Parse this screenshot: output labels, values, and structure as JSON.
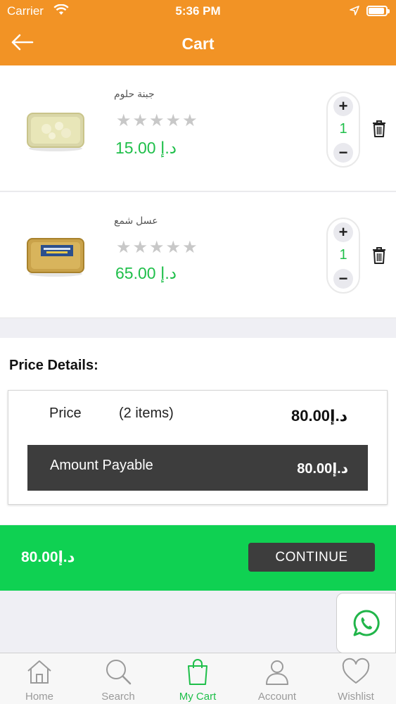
{
  "status_bar": {
    "carrier": "Carrier",
    "time": "5:36 PM"
  },
  "header": {
    "title": "Cart"
  },
  "cart_items": [
    {
      "name": "جبنة حلوم",
      "rating": 0,
      "price": "15.00 د.إ",
      "quantity": "1"
    },
    {
      "name": "عسل شمع",
      "rating": 0,
      "price": "65.00 د.إ",
      "quantity": "1"
    }
  ],
  "stepper": {
    "plus": "+",
    "minus": "−"
  },
  "price_details": {
    "heading": "Price Details:",
    "price_label": "Price",
    "items_count": "(2 items)",
    "price_value": "80.00د.إ",
    "amount_label": "Amount Payable",
    "amount_value": "80.00د.إ"
  },
  "footer": {
    "total": "80.00د.إ",
    "continue_label": "CONTINUE"
  },
  "tabs": [
    {
      "label": "Home",
      "icon": "home-icon",
      "active": false
    },
    {
      "label": "Search",
      "icon": "search-icon",
      "active": false
    },
    {
      "label": "My Cart",
      "icon": "shopping-bag-icon",
      "active": true
    },
    {
      "label": "Account",
      "icon": "user-icon",
      "active": false
    },
    {
      "label": "Wishlist",
      "icon": "heart-icon",
      "active": false
    }
  ],
  "colors": {
    "brand_orange": "#f29325",
    "accent_green": "#1fbf4a",
    "bar_green": "#0fd152",
    "dark": "#3d3d3d"
  }
}
